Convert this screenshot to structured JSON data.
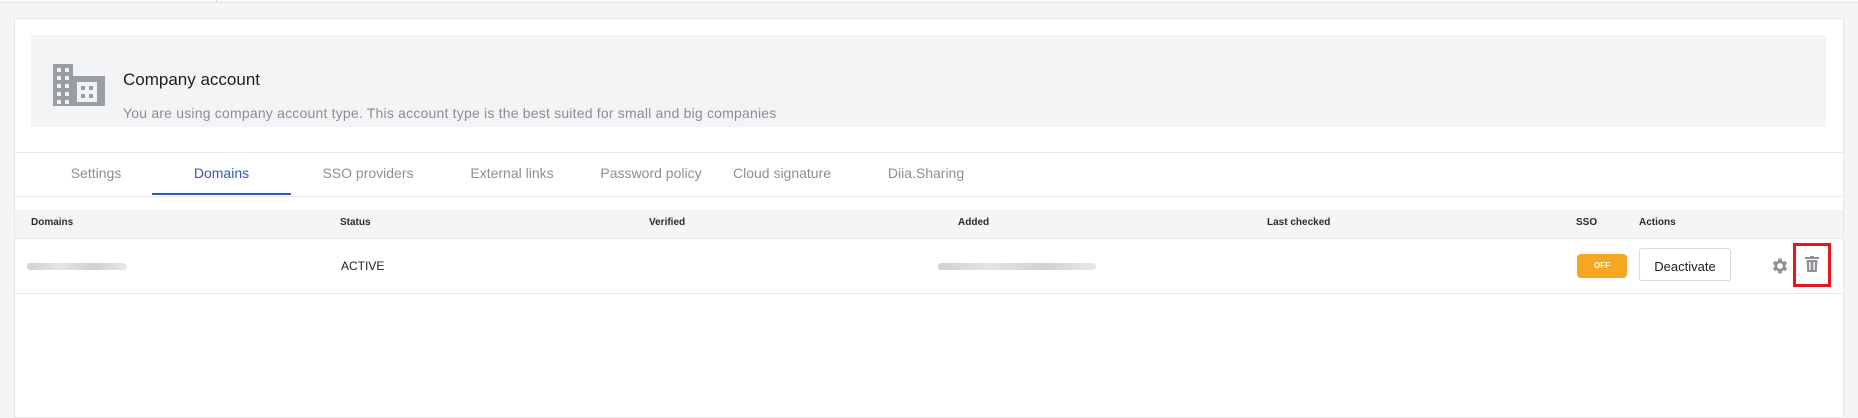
{
  "account": {
    "title": "Company account",
    "description": "You are using company account type. This account type is the best suited for small and big companies",
    "icon": "building-icon"
  },
  "tabs": [
    {
      "label": "Settings",
      "active": false
    },
    {
      "label": "Domains",
      "active": true
    },
    {
      "label": "SSO providers",
      "active": false
    },
    {
      "label": "External links",
      "active": false
    },
    {
      "label": "Password policy",
      "active": false
    },
    {
      "label": "Cloud signature",
      "active": false
    },
    {
      "label": "Diia.Sharing",
      "active": false
    }
  ],
  "table": {
    "headers": {
      "domains": "Domains",
      "status": "Status",
      "verified": "Verified",
      "added": "Added",
      "last_checked": "Last checked",
      "sso": "SSO",
      "actions": "Actions"
    },
    "rows": [
      {
        "status": "ACTIVE",
        "sso": "OFF",
        "deactivate_label": "Deactivate"
      }
    ]
  },
  "colors": {
    "accent": "#2f5cb8",
    "sso_off": "#f5a623",
    "highlight": "#e3161b"
  }
}
